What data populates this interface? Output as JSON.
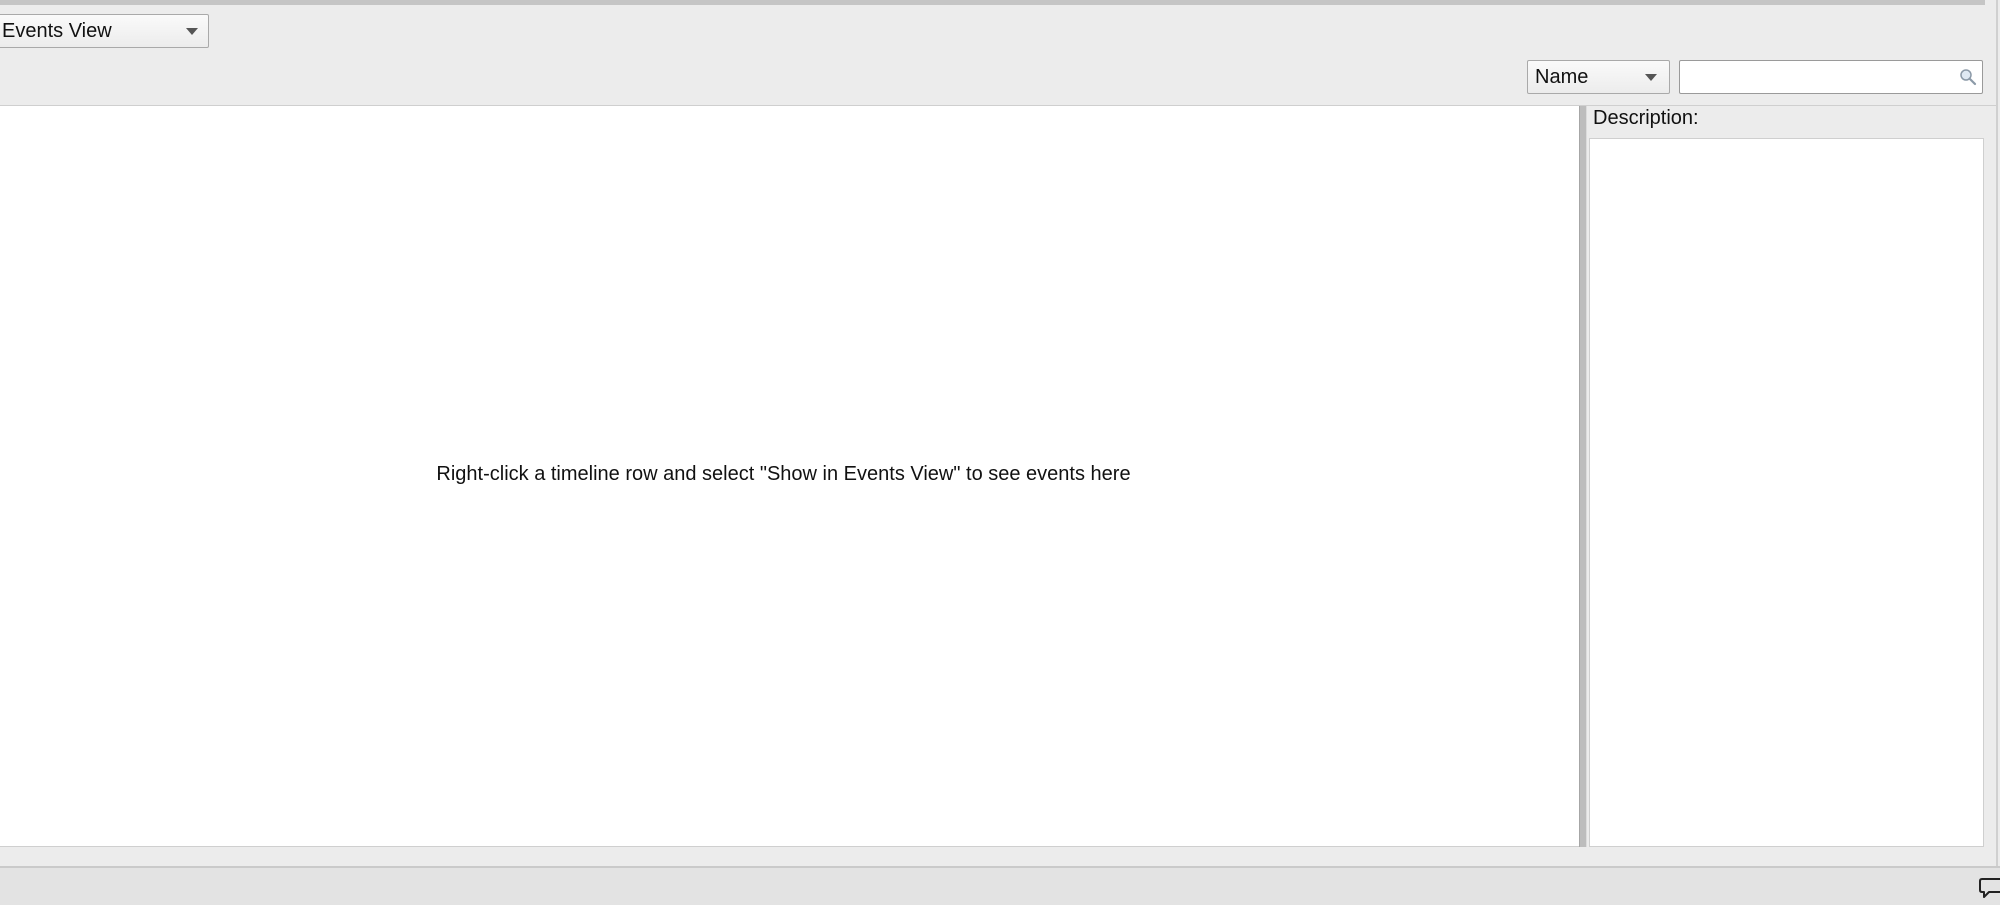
{
  "toolbar": {
    "view_selector": "Events View",
    "search_field_selector": "Name",
    "search_value": ""
  },
  "events_panel": {
    "empty_message": "Right-click a timeline row and select \"Show in Events View\" to see events here"
  },
  "description_panel": {
    "label": "Description:"
  },
  "icons": {
    "search": "search-icon",
    "chat": "chat-bubble-icon",
    "dropdown": "chevron-down-icon"
  }
}
